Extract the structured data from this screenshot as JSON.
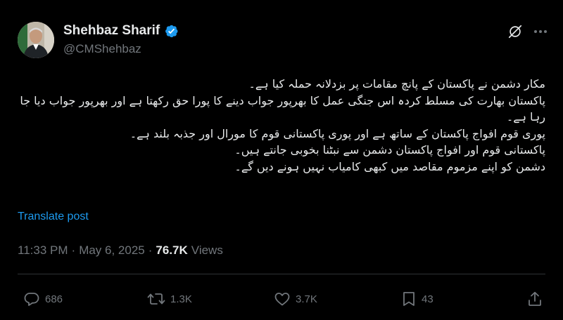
{
  "author": {
    "name": "Shehbaz Sharif",
    "handle": "@CMShehbaz",
    "verified": true,
    "verified_color": "#1d9bf0"
  },
  "post": {
    "lines": [
      "مکار دشمن نے پاکستان کے پانچ مقامات پر بزدلانہ حملہ کیا ہے۔",
      "پاکستان بھارت کی مسلط کردہ اس جنگی عمل کا بھرپور جواب دینے کا پورا حق رکھتا ہے اور بھرپور جواب دیا جا رہا ہے۔",
      "پوری قوم افواج پاکستان کے ساتھ ہے اور پوری پاکستانی قوم کا مورال اور جذبہ بلند ہے۔",
      "پاکستانی قوم اور افواج پاکستان دشمن سے نبٹنا بخوبی جانتے ہیں۔",
      "دشمن کو اپنے مزموم مقاصد میں کبھی کامیاب نہیں ہونے دیں گے۔"
    ],
    "translate_label": "Translate post",
    "time": "11:33 PM",
    "separator": "·",
    "date": "May 6, 2025",
    "views_count": "76.7K",
    "views_label": "Views"
  },
  "actions": {
    "replies": "686",
    "reposts": "1.3K",
    "likes": "3.7K",
    "bookmarks": "43"
  },
  "icons": {
    "grok": "grok-icon",
    "more": "more-icon",
    "reply": "reply-icon",
    "repost": "repost-icon",
    "like": "heart-icon",
    "bookmark": "bookmark-icon",
    "share": "share-icon"
  },
  "colors": {
    "background": "#000000",
    "text": "#e7e9ea",
    "muted": "#71767b",
    "link": "#1d9bf0",
    "divider": "#2f3336"
  }
}
